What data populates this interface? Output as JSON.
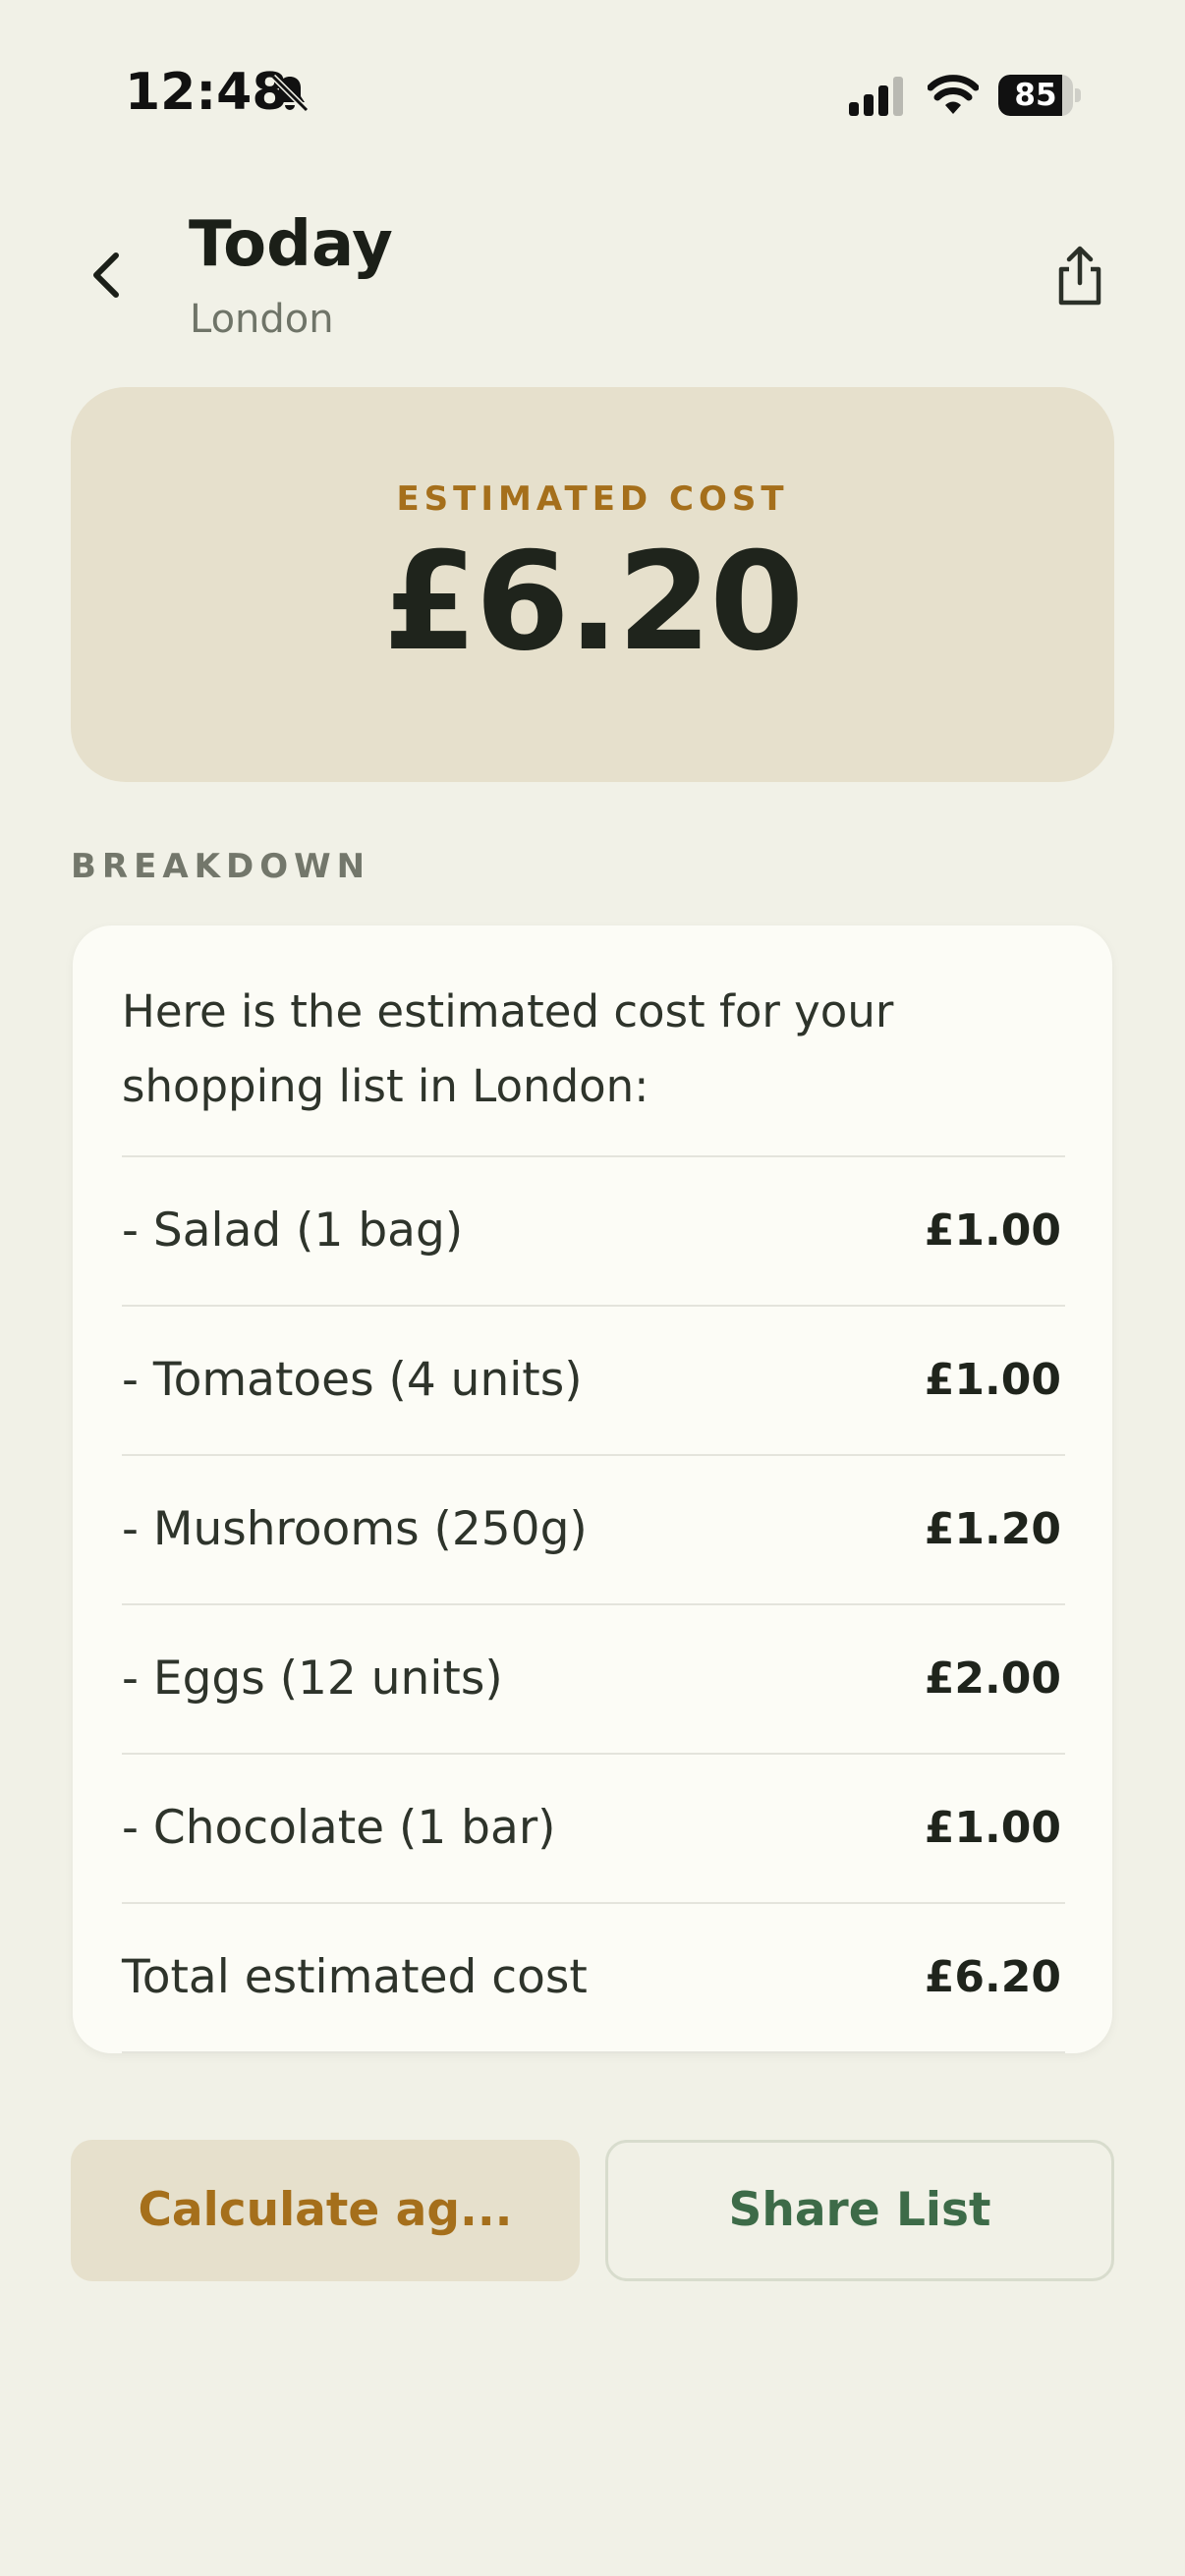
{
  "status_bar": {
    "time": "12:48",
    "battery_percent": "85",
    "battery_level": 0.85,
    "icons": [
      "bell-slash-icon",
      "signal-icon",
      "wifi-icon",
      "battery-icon"
    ]
  },
  "header": {
    "title": "Today",
    "subtitle": "London",
    "icons": [
      "chevron-left-icon",
      "share-icon"
    ]
  },
  "summary": {
    "label": "ESTIMATED COST",
    "value": "£6.20"
  },
  "breakdown": {
    "section_label": "BREAKDOWN",
    "intro": "Here is the estimated cost for your shopping list in London:",
    "rows": [
      {
        "label": "- Salad (1 bag)",
        "price": "£1.00"
      },
      {
        "label": "- Tomatoes (4 units)",
        "price": "£1.00"
      },
      {
        "label": "- Mushrooms (250g)",
        "price": "£1.20"
      },
      {
        "label": "- Eggs (12 units)",
        "price": "£2.00"
      },
      {
        "label": "- Chocolate (1 bar)",
        "price": "£1.00"
      },
      {
        "label": "Total estimated cost",
        "price": "£6.20"
      }
    ]
  },
  "actions": {
    "calculate_label": "Calculate ag...",
    "share_label": "Share List"
  },
  "colors": {
    "background": "#f1f1e7",
    "accent_gold": "#a56f1b",
    "accent_green": "#3d6b48",
    "card_beige": "#e6e0cc"
  }
}
